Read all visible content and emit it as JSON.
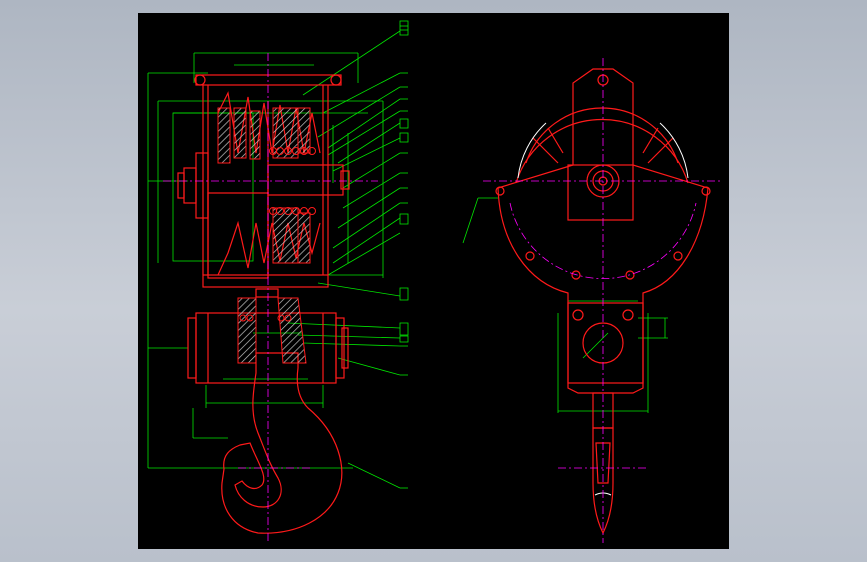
{
  "colors": {
    "background": "#b9c0cb",
    "sheet": "#000000",
    "outline": "#ff1a1a",
    "dimension": "#00e600",
    "centerline": "#ff00ff",
    "hatch": "#c8c8c8",
    "highlight": "#ffffff"
  },
  "views": [
    "front-section-view",
    "side-view"
  ],
  "icons": [
    "hook-block-drawing"
  ]
}
